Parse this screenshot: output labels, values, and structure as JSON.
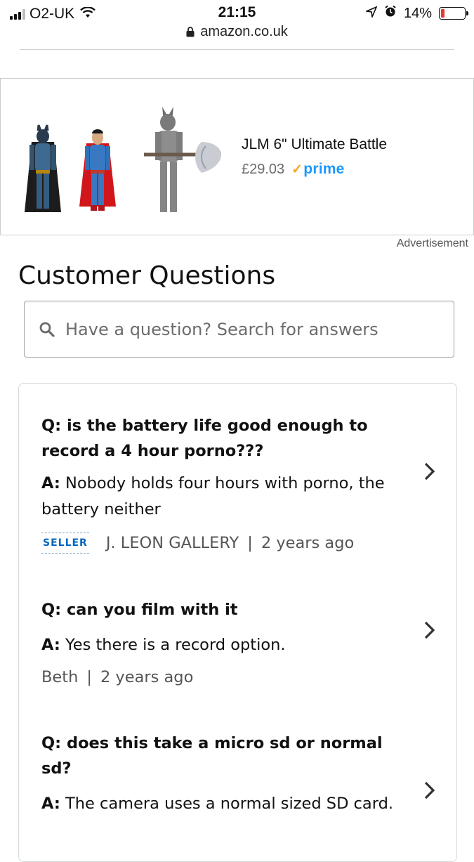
{
  "status_bar": {
    "carrier": "O2-UK",
    "time": "21:15",
    "battery_percent": "14%"
  },
  "url": "amazon.co.uk",
  "ad": {
    "title": "JLM 6\" Ultimate Battle",
    "price": "£29.03",
    "prime_label": "prime",
    "label": "Advertisement"
  },
  "page_title": "Customer Questions",
  "search": {
    "placeholder": "Have a question? Search for answers"
  },
  "questions": [
    {
      "question": "Q: is the battery life good enough to record a 4 hour porno???",
      "answer_prefix": "A:",
      "answer": "Nobody holds four hours with porno, the battery neither",
      "badge": "SELLER",
      "author": "J. LEON GALLERY",
      "age": "2 years ago"
    },
    {
      "question": "Q: can you film with it",
      "answer_prefix": "A:",
      "answer": "Yes there is a record option.",
      "author": "Beth",
      "age": "2 years ago"
    },
    {
      "question": "Q: does this take a micro sd or normal sd?",
      "answer_prefix": "A:",
      "answer": "The camera uses a normal sized SD card."
    }
  ],
  "colors": {
    "prime_blue": "#1a98ff",
    "prime_check": "#f5a623",
    "seller_blue": "#0066c0"
  }
}
